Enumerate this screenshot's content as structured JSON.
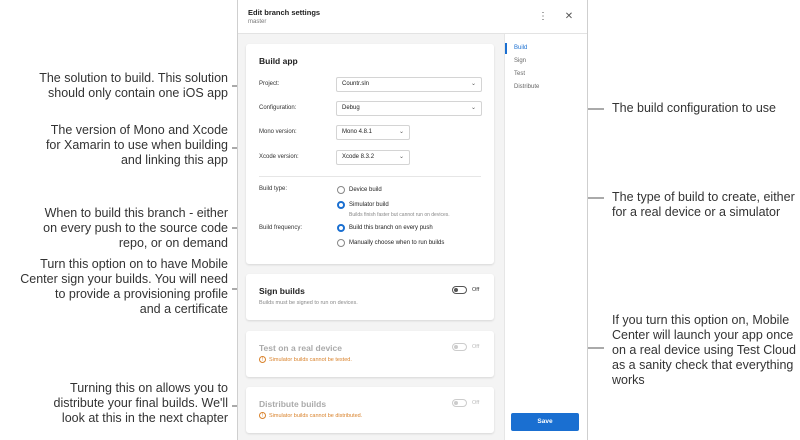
{
  "annotations": {
    "solution": [
      "The solution to build. This solution",
      "should only contain one iOS app"
    ],
    "mono": [
      "The version of Mono and Xcode",
      "for Xamarin to use when building",
      "and linking this app"
    ],
    "when": [
      "When to build this branch - either",
      "on every push to the source code",
      "repo, or on demand"
    ],
    "sign": [
      "Turn this option on to have Mobile",
      "Center sign your builds. You will need",
      "to provide a provisioning profile",
      "and a certificate"
    ],
    "distribute": [
      "Turning this on allows you to",
      "distribute your final builds. We'll",
      "look at this in the next chapter"
    ],
    "config": [
      "The build configuration to use"
    ],
    "type": [
      "The type of build to create, either",
      "for a real device or a simulator"
    ],
    "testcloud": [
      "If you turn this option on, Mobile",
      "Center will launch your app once",
      "on a real device using Test Cloud",
      "as a sanity check that everything",
      "works"
    ]
  },
  "header": {
    "title": "Edit branch settings",
    "subtitle": "master",
    "more_icon": "more-vertical-icon",
    "close_icon": "close-icon"
  },
  "build_app": {
    "title": "Build app",
    "project": {
      "label": "Project:",
      "value": "Countr.sln"
    },
    "configuration": {
      "label": "Configuration:",
      "value": "Debug"
    },
    "mono": {
      "label": "Mono version:",
      "value": "Mono 4.8.1"
    },
    "xcode": {
      "label": "Xcode version:",
      "value": "Xcode 8.3.2"
    },
    "build_type": {
      "label": "Build type:",
      "options": [
        "Device build",
        "Simulator build"
      ],
      "selected": "Simulator build",
      "hint": "Builds finish faster but cannot run on devices."
    },
    "frequency": {
      "label": "Build frequency:",
      "options": [
        "Build this branch on every push",
        "Manually choose when to run builds"
      ],
      "selected": "Build this branch on every push"
    }
  },
  "sign_builds": {
    "title": "Sign builds",
    "toggle": "Off",
    "hint": "Builds must be signed to run on devices."
  },
  "test_device": {
    "title": "Test on a real device",
    "toggle": "Off",
    "warning": "Simulator builds cannot be tested."
  },
  "distribute": {
    "title": "Distribute builds",
    "toggle": "Off",
    "warning": "Simulator builds cannot be distributed."
  },
  "nav": {
    "items": [
      "Build",
      "Sign",
      "Test",
      "Distribute"
    ],
    "active": "Build"
  },
  "save_label": "Save",
  "colors": {
    "accent": "#1a6fd1",
    "warning": "#d9822b"
  }
}
